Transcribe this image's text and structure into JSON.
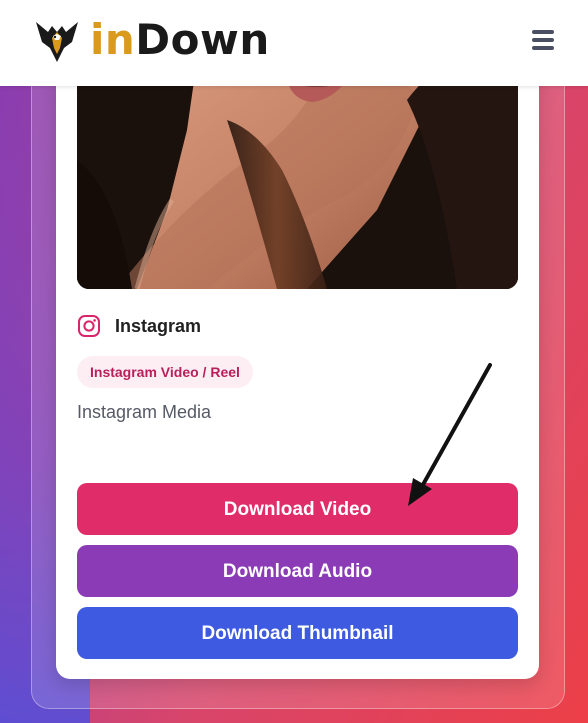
{
  "header": {
    "logo_in": "in",
    "logo_down": "Down",
    "menu_icon": "hamburger-menu-icon",
    "logo_icon": "eagle-logo-icon"
  },
  "result": {
    "thumbnail_icon": "media-thumbnail-image",
    "platform_icon": "instagram-icon",
    "platform_name": "Instagram",
    "tag": "Instagram Video / Reel",
    "media_title": "Instagram Media"
  },
  "buttons": {
    "download_video": "Download Video",
    "download_audio": "Download Audio",
    "download_thumbnail": "Download Thumbnail"
  },
  "colors": {
    "brand_gold": "#d99a1e",
    "video_button": "#e02d69",
    "audio_button": "#8a3bb5",
    "thumbnail_button": "#3d5ae0",
    "tag_text": "#b8205a"
  }
}
